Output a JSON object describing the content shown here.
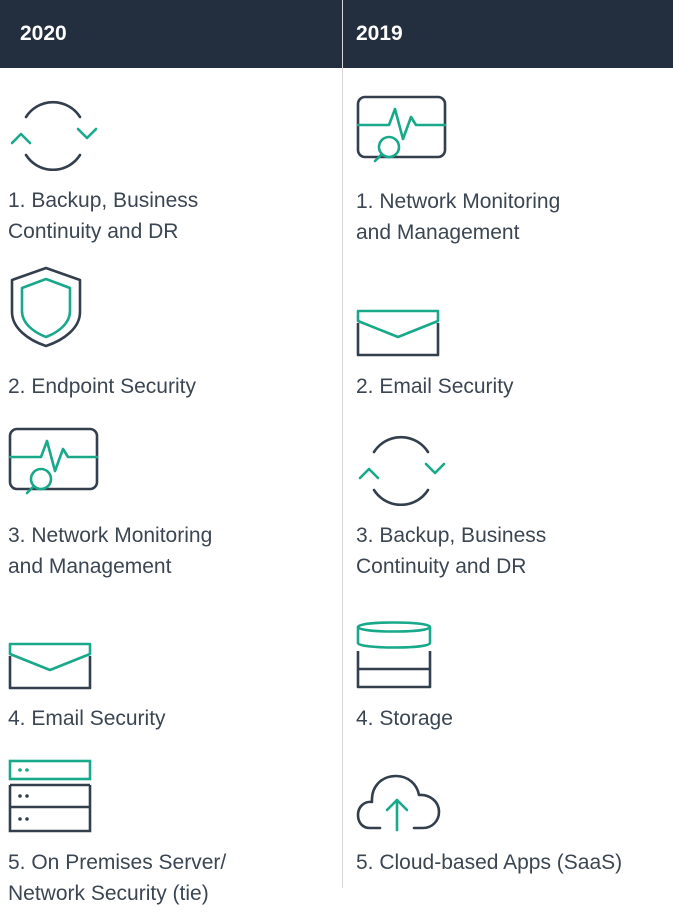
{
  "colors": {
    "header_bg": "#232f3e",
    "accent": "#17a98a",
    "icon_dark": "#333f4c",
    "text": "#3b4652"
  },
  "columns": {
    "left": {
      "year": "2020",
      "items": [
        {
          "icon": "sync-arrows-icon",
          "lines": [
            "1. Backup, Business",
            "Continuity and DR"
          ]
        },
        {
          "icon": "shield-icon",
          "lines": [
            "2. Endpoint Security"
          ]
        },
        {
          "icon": "monitor-search-icon",
          "lines": [
            "3. Network Monitoring",
            "and Management"
          ]
        },
        {
          "icon": "envelope-icon",
          "lines": [
            "4. Email Security"
          ]
        },
        {
          "icon": "server-rack-icon",
          "lines": [
            "5. On Premises Server/",
            "Network Security (tie)"
          ]
        }
      ]
    },
    "right": {
      "year": "2019",
      "items": [
        {
          "icon": "monitor-search-icon",
          "lines": [
            "1. Network Monitoring",
            "and Management"
          ]
        },
        {
          "icon": "envelope-icon",
          "lines": [
            "2. Email Security"
          ]
        },
        {
          "icon": "sync-arrows-icon",
          "lines": [
            "3. Backup, Business",
            "Continuity and DR"
          ]
        },
        {
          "icon": "database-storage-icon",
          "lines": [
            "4. Storage"
          ]
        },
        {
          "icon": "cloud-upload-icon",
          "lines": [
            "5. Cloud-based Apps (SaaS)"
          ]
        }
      ]
    }
  }
}
